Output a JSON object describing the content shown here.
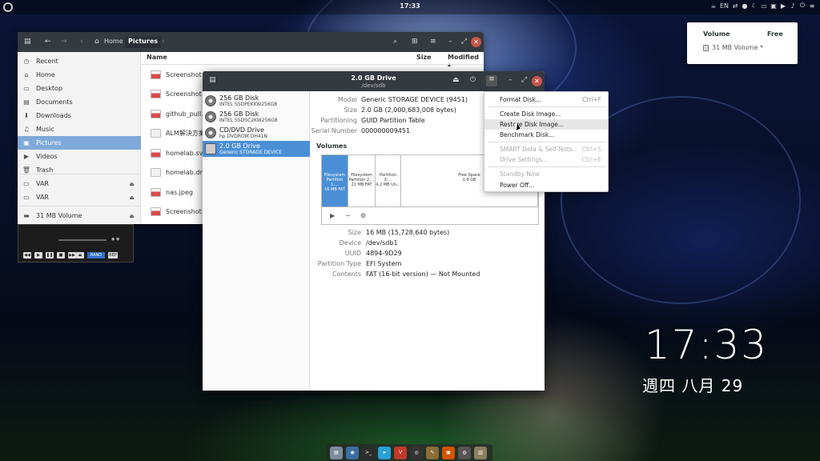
{
  "top_panel": {
    "clock": "17:33",
    "tray": [
      "☕",
      "EN",
      "⇄",
      "●",
      "☾",
      "▭",
      "▣",
      "▶",
      "♪",
      "⏻",
      "≡"
    ]
  },
  "volume_popup": {
    "col_volume": "Volume",
    "col_free": "Free",
    "entry": "31 MB Volume *"
  },
  "desktop_clock": {
    "time": "17:33",
    "date": "週四 八月 29"
  },
  "files": {
    "path": [
      "Home",
      "Pictures"
    ],
    "columns": {
      "name": "Name",
      "size": "Size",
      "modified": "Modified"
    },
    "sidebar": [
      {
        "label": "Recent",
        "icon": "recent-icon",
        "glyph": "◷"
      },
      {
        "label": "Home",
        "icon": "home-icon",
        "glyph": "⌂"
      },
      {
        "label": "Desktop",
        "icon": "desktop-icon",
        "glyph": "▭"
      },
      {
        "label": "Documents",
        "icon": "documents-icon",
        "glyph": "▤"
      },
      {
        "label": "Downloads",
        "icon": "downloads-icon",
        "glyph": "⬇"
      },
      {
        "label": "Music",
        "icon": "music-icon",
        "glyph": "♫"
      },
      {
        "label": "Pictures",
        "icon": "pictures-icon",
        "glyph": "▣"
      },
      {
        "label": "Videos",
        "icon": "videos-icon",
        "glyph": "▶"
      },
      {
        "label": "Trash",
        "icon": "trash-icon",
        "glyph": "🗑"
      },
      {
        "label": "VAR",
        "icon": "drive-icon",
        "glyph": "▭"
      },
      {
        "label": "VAR",
        "icon": "drive-icon",
        "glyph": "▭"
      },
      {
        "label": "31 MB Volume",
        "icon": "drive-icon",
        "glyph": "▬"
      }
    ],
    "items": [
      {
        "name": "Screenshot f",
        "type": "img"
      },
      {
        "name": "Screenshot f",
        "type": "img"
      },
      {
        "name": "github_pull.p",
        "type": "img"
      },
      {
        "name": "ALM解決方案",
        "type": "doc"
      },
      {
        "name": "homelab.svg",
        "type": "img"
      },
      {
        "name": "homelab.dra",
        "type": "doc"
      },
      {
        "name": "nas.jpeg",
        "type": "img"
      },
      {
        "name": "Screenshot f",
        "type": "img"
      }
    ]
  },
  "player": {
    "buttons": [
      "◀◀",
      "▶",
      "❚❚",
      "■",
      "▶▶",
      "⏏",
      "RAND",
      "REP"
    ]
  },
  "disks": {
    "title": "2.0 GB Drive",
    "subtitle": "/dev/sdb",
    "drives": [
      {
        "name": "256 GB Disk",
        "detail": "INTEL SSDPEKKW256G8",
        "kind": "disk"
      },
      {
        "name": "256 GB Disk",
        "detail": "INTEL SSDSC2KW256G8",
        "kind": "disk"
      },
      {
        "name": "CD/DVD Drive",
        "detail": "hp      DVDROM DH41N",
        "kind": "disk"
      },
      {
        "name": "2.0 GB Drive",
        "detail": "Generic STORAGE DEVICE",
        "kind": "usb"
      }
    ],
    "drive_info": [
      {
        "label": "Model",
        "value": "Generic STORAGE DEVICE (9451)"
      },
      {
        "label": "Size",
        "value": "2.0 GB (2,000,683,008 bytes)"
      },
      {
        "label": "Partitioning",
        "value": "GUID Partition Table"
      },
      {
        "label": "Serial Number",
        "value": "000000009451"
      }
    ],
    "volumes_label": "Volumes",
    "segments": [
      {
        "line1": "Filesystem",
        "line2": "Partition 1:...",
        "line3": "16 MB FAT",
        "selected": true
      },
      {
        "line1": "Filesystem",
        "line2": "Partition 2:...",
        "line3": "21 MB FAT",
        "selected": false
      },
      {
        "line1": "Partition 3:...",
        "line2": "4.2 MB Un...",
        "line3": "",
        "selected": false
      },
      {
        "line1": "Free Space",
        "line2": "1.9 GB",
        "line3": "",
        "selected": false
      }
    ],
    "tools": [
      "▶",
      "−",
      "⚙"
    ],
    "partition_info": [
      {
        "label": "Size",
        "value": "16 MB (15,728,640 bytes)"
      },
      {
        "label": "Device",
        "value": "/dev/sdb1"
      },
      {
        "label": "UUID",
        "value": "4894-9D29"
      },
      {
        "label": "Partition Type",
        "value": "EFI System"
      },
      {
        "label": "Contents",
        "value": "FAT (16-bit version) — Not Mounted"
      }
    ]
  },
  "menu": {
    "items": [
      {
        "label": "Format Disk...",
        "accel": "Ctrl+F",
        "disabled": false
      },
      {
        "label": "Create Disk Image...",
        "accel": "",
        "disabled": false
      },
      {
        "label": "Restore Disk Image...",
        "accel": "",
        "disabled": false
      },
      {
        "label": "Benchmark Disk...",
        "accel": "",
        "disabled": false
      },
      {
        "label": "SMART Data & Self-Tests...",
        "accel": "Ctrl+S",
        "disabled": true
      },
      {
        "label": "Drive Settings...",
        "accel": "Ctrl+E",
        "disabled": true
      },
      {
        "label": "Standby Now",
        "accel": "",
        "disabled": true
      },
      {
        "label": "Power Off...",
        "accel": "",
        "disabled": false
      }
    ]
  },
  "dock": {
    "items": [
      {
        "name": "files",
        "color": "#7d8c9e",
        "glyph": "▤"
      },
      {
        "name": "browser",
        "color": "#3a6ea5",
        "glyph": "◉"
      },
      {
        "name": "terminal",
        "color": "#2d2d2d",
        "glyph": ">_"
      },
      {
        "name": "telegram",
        "color": "#2a9fd8",
        "glyph": "➤"
      },
      {
        "name": "vivaldi",
        "color": "#c0392b",
        "glyph": "V"
      },
      {
        "name": "obs",
        "color": "#333",
        "glyph": "◎"
      },
      {
        "name": "gimp",
        "color": "#8a6d3b",
        "glyph": "✎"
      },
      {
        "name": "impress",
        "color": "#d35400",
        "glyph": "▣"
      },
      {
        "name": "disks",
        "color": "#555",
        "glyph": "◍"
      },
      {
        "name": "archive",
        "color": "#8e7f60",
        "glyph": "▥"
      }
    ]
  }
}
